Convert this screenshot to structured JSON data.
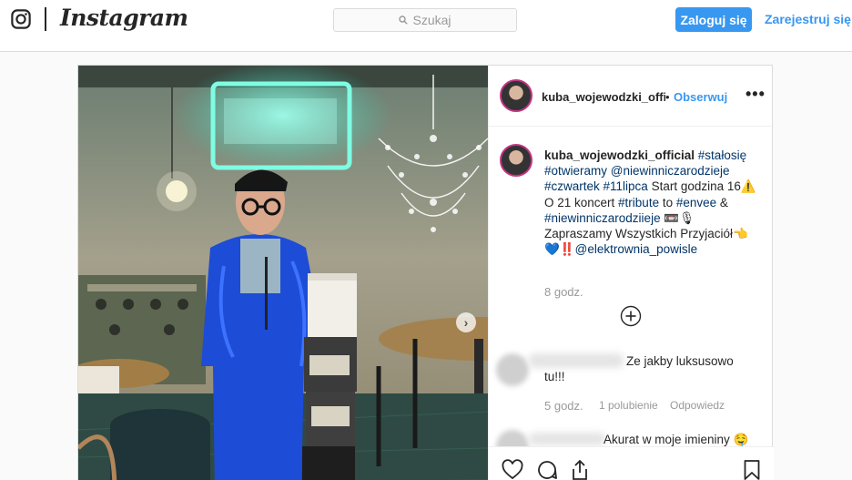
{
  "nav": {
    "brand": "Instagram",
    "search_placeholder": "Szukaj",
    "login_label": "Zaloguj się",
    "register_label": "Zarejestruj się",
    "accent_color": "#3897f0"
  },
  "post": {
    "username": "kuba_wojewodzki_offic",
    "follow_label": "Obserwuj",
    "more_label": "•••",
    "caption": {
      "username": "kuba_wojewodzki_official",
      "segments": [
        {
          "text": " #stałosię",
          "tag": true
        },
        {
          "text": " #otwieramy",
          "tag": true
        },
        {
          "text": " @niewinniczarodzieje",
          "tag": true
        },
        {
          "text": " #czwartek",
          "tag": true
        },
        {
          "text": " #11lipca",
          "tag": true
        },
        {
          "text": " Start godzina 16⚠️ O 21 koncert",
          "tag": false
        },
        {
          "text": " #tribute",
          "tag": true
        },
        {
          "text": " to ",
          "tag": false
        },
        {
          "text": "#envee",
          "tag": true
        },
        {
          "text": " & ",
          "tag": false
        },
        {
          "text": "#niewinniczarodziieje",
          "tag": true
        },
        {
          "text": " 📼🎙 Zapraszamy Wszystkich Przyjaciół👈 💙‼️",
          "tag": false
        },
        {
          "text": "@elektrownia_powisle",
          "tag": true
        }
      ],
      "time": "8 godz."
    },
    "comments": [
      {
        "text": "Ze jakby luksusowo tu!!!",
        "time": "5 godz.",
        "likes": "1 polubienie",
        "reply": "Odpowiedz"
      },
      {
        "text": "Akurat w moje imieniny 🤤"
      }
    ]
  }
}
